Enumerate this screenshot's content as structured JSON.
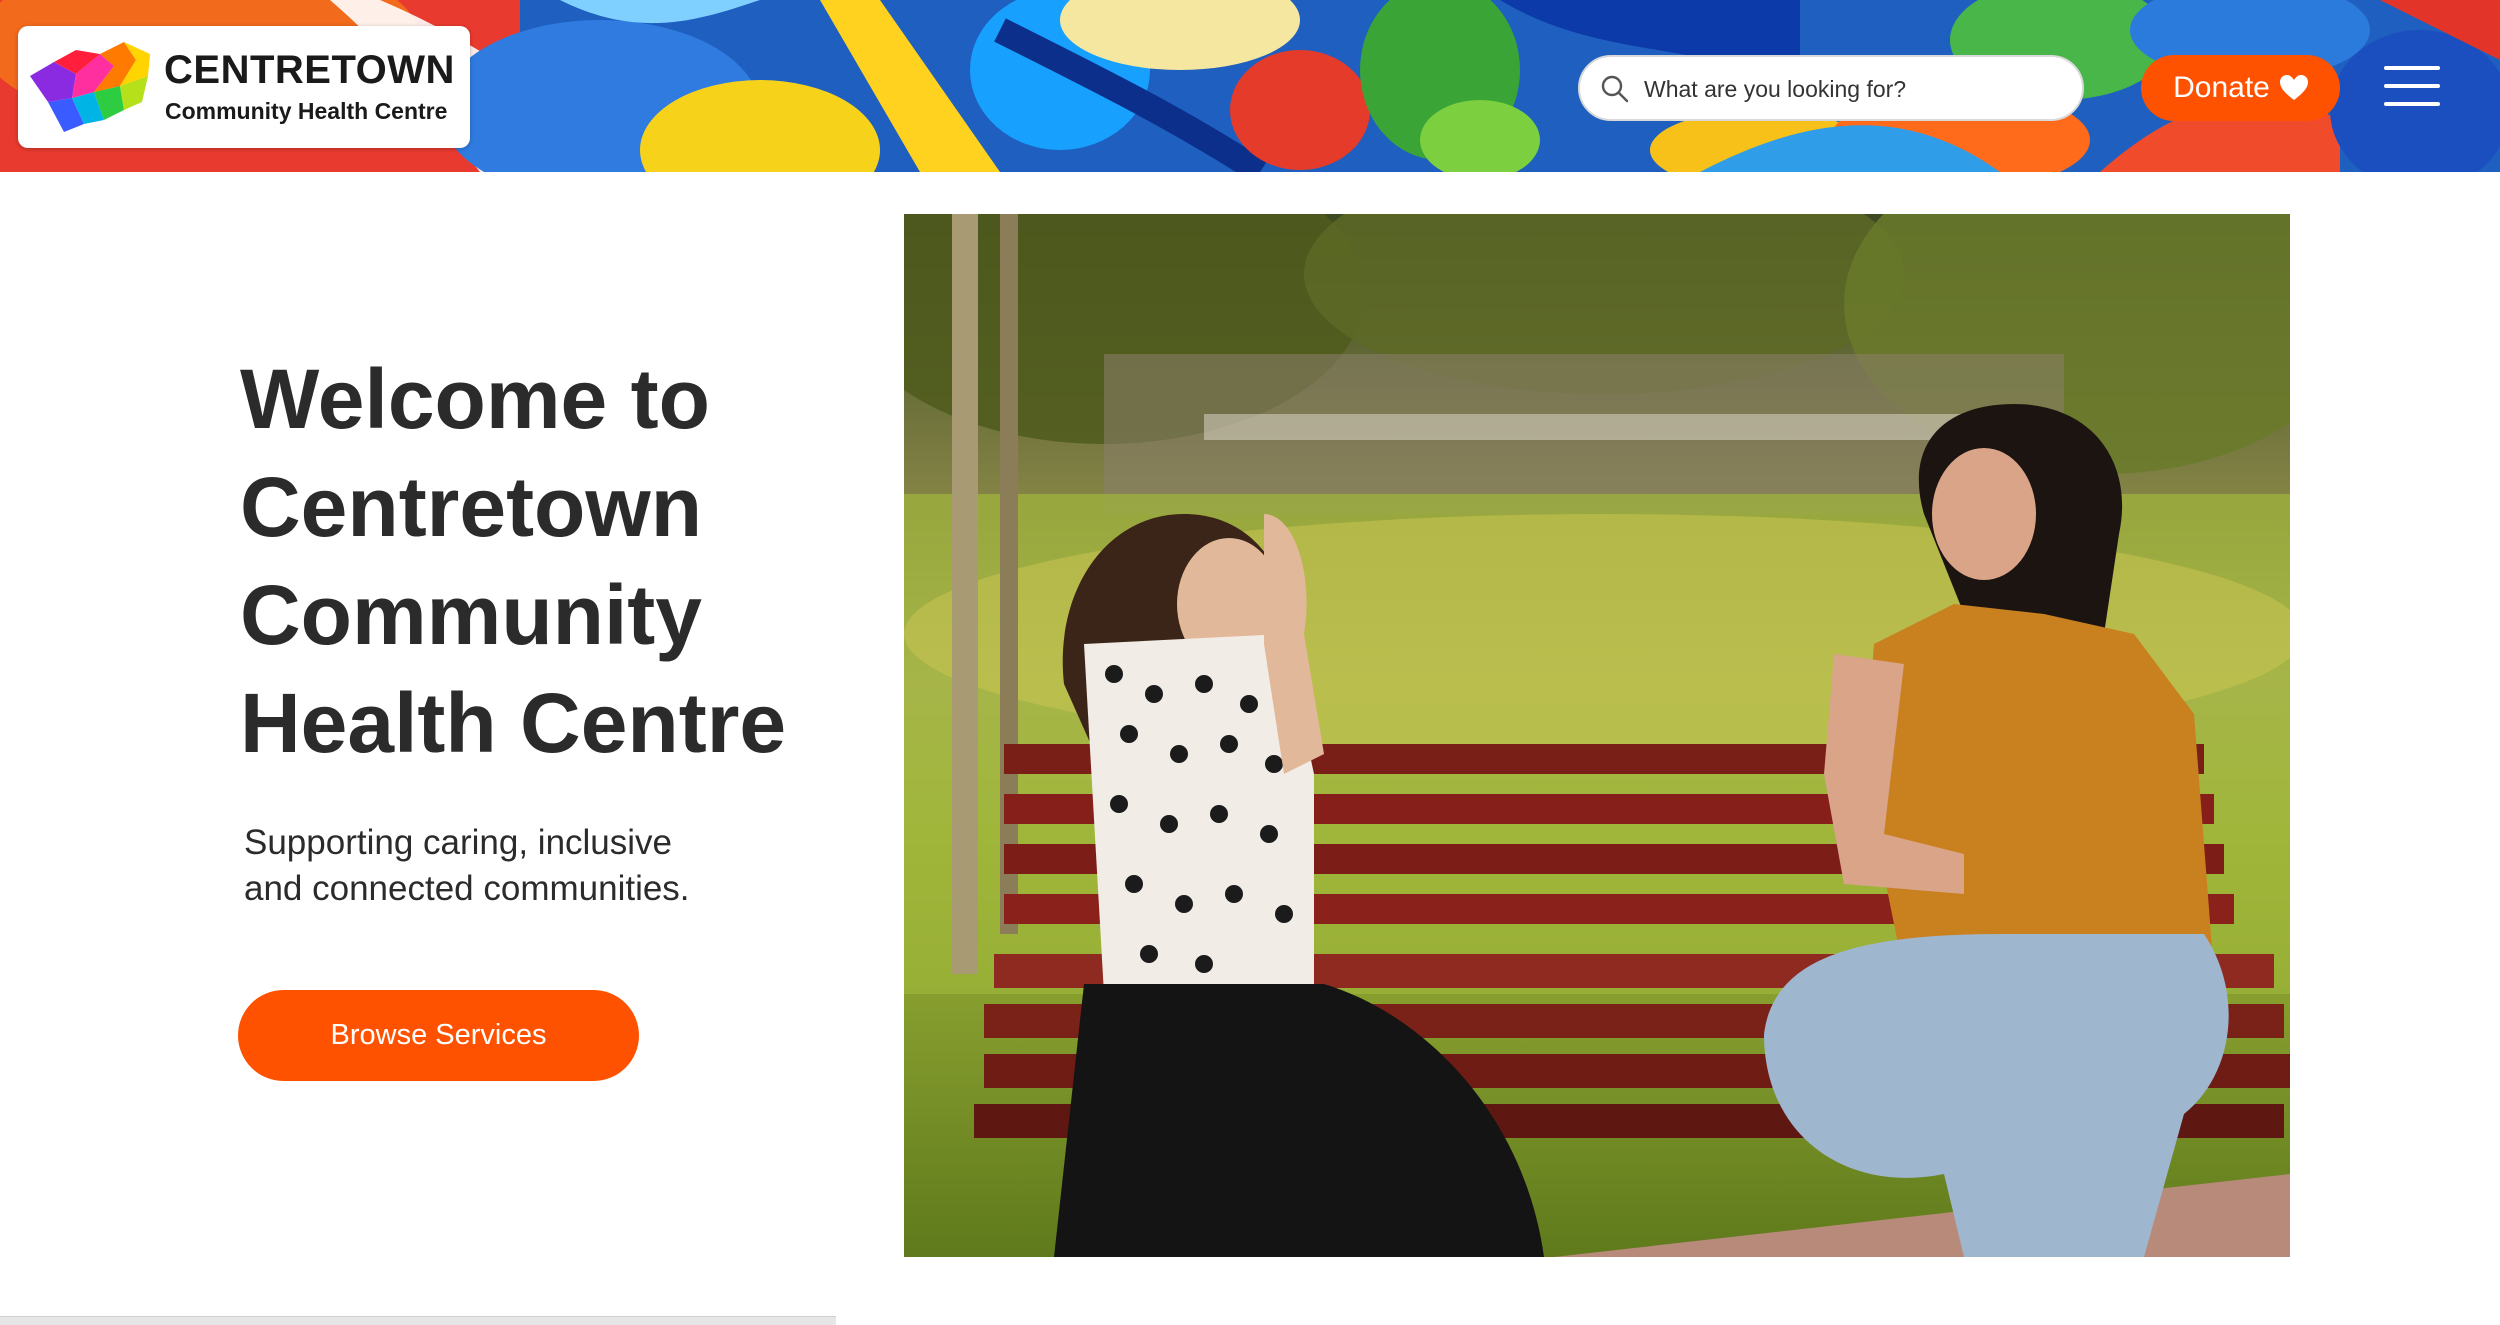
{
  "header": {
    "logo": {
      "title": "CENTRETOWN",
      "subtitle": "Community Health Centre"
    },
    "search": {
      "placeholder": "What are you looking for?",
      "icon": "search-icon"
    },
    "donate": {
      "label": "Donate",
      "icon": "heart-icon"
    },
    "menu": {
      "icon": "hamburger-menu-icon"
    }
  },
  "hero": {
    "title_lines": [
      "Welcome to",
      "Centretown",
      "Community",
      "Health Centre"
    ],
    "subtitle_lines": [
      "Supporting caring, inclusive",
      "and connected communities."
    ],
    "cta_label": "Browse Services",
    "image": "photo-two-women-on-park-bench"
  },
  "colors": {
    "accent": "#ff5200",
    "text": "#2b2b2b",
    "background": "#ffffff"
  }
}
